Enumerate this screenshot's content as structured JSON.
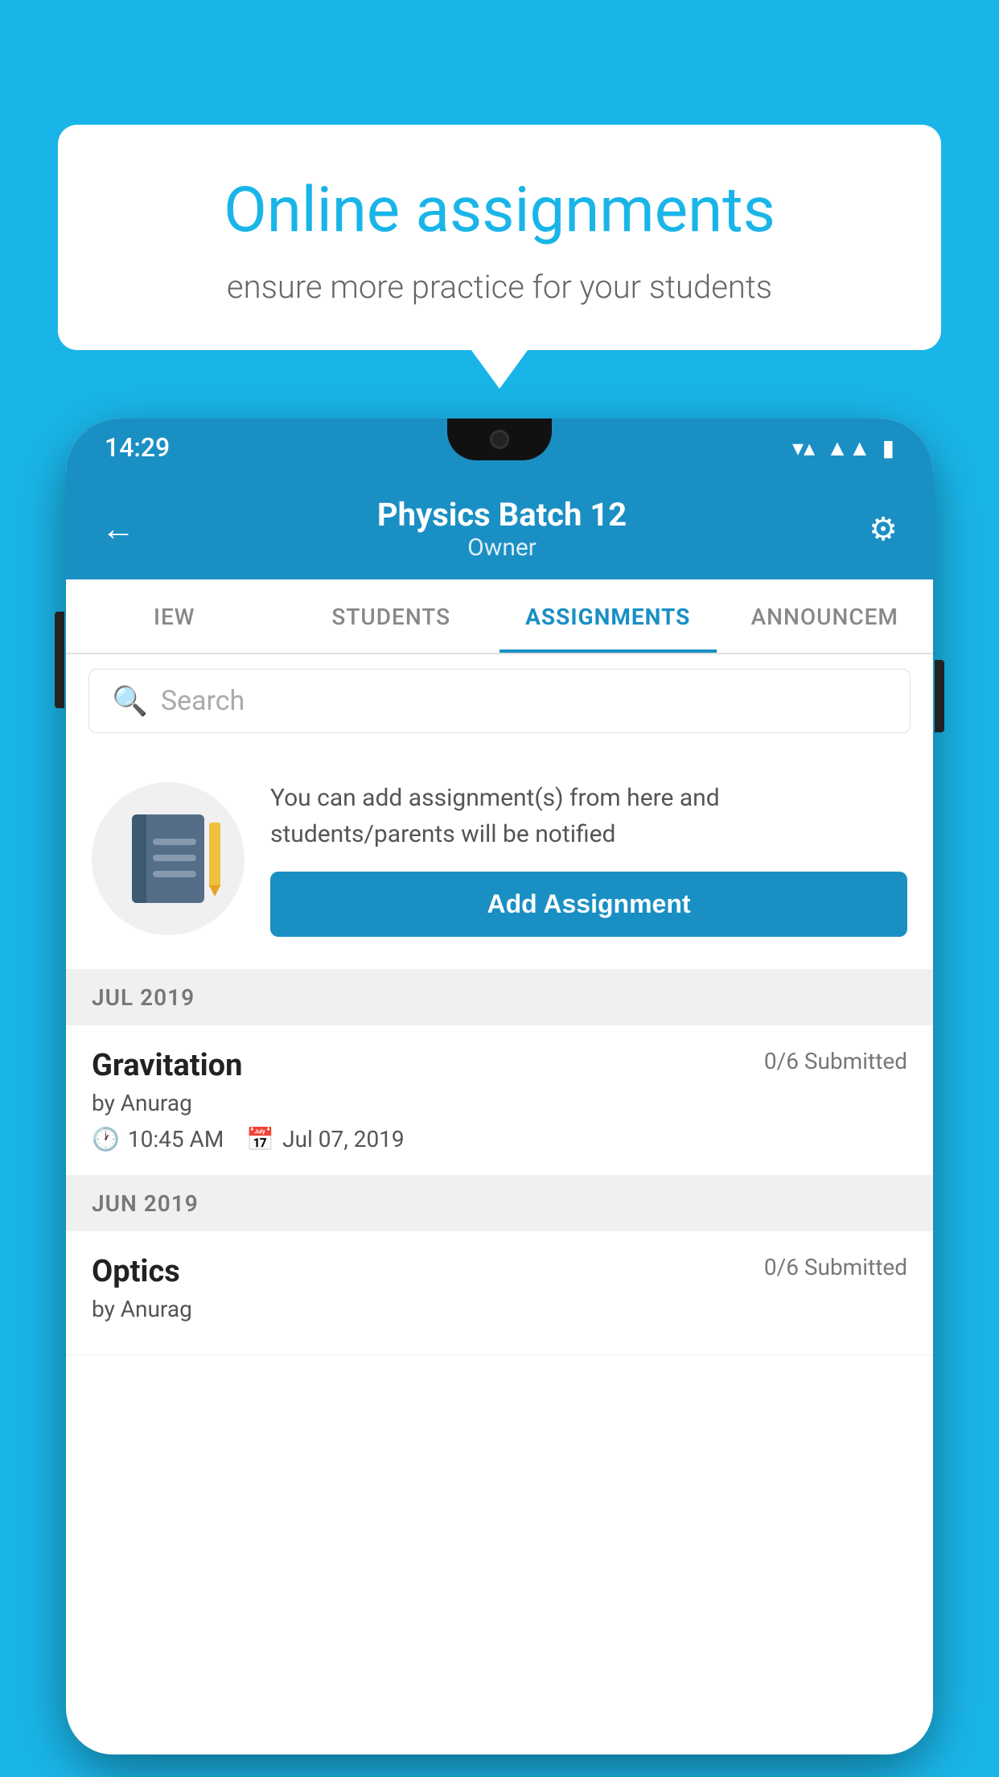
{
  "background": {
    "color": "#1ab5e8"
  },
  "speech_bubble": {
    "title": "Online assignments",
    "subtitle": "ensure more practice for your students"
  },
  "phone": {
    "status_bar": {
      "time": "14:29",
      "wifi": "wifi",
      "signal": "signal",
      "battery": "battery"
    },
    "header": {
      "title": "Physics Batch 12",
      "subtitle": "Owner",
      "back_label": "←",
      "settings_label": "⚙"
    },
    "tabs": [
      {
        "label": "IEW",
        "active": false
      },
      {
        "label": "STUDENTS",
        "active": false
      },
      {
        "label": "ASSIGNMENTS",
        "active": true
      },
      {
        "label": "ANNOUNCEM",
        "active": false
      }
    ],
    "search": {
      "placeholder": "Search"
    },
    "add_assignment": {
      "description": "You can add assignment(s) from here and students/parents will be notified",
      "button_label": "Add Assignment"
    },
    "sections": [
      {
        "month": "JUL 2019",
        "assignments": [
          {
            "title": "Gravitation",
            "submitted": "0/6 Submitted",
            "by": "by Anurag",
            "time": "10:45 AM",
            "date": "Jul 07, 2019"
          }
        ]
      },
      {
        "month": "JUN 2019",
        "assignments": [
          {
            "title": "Optics",
            "submitted": "0/6 Submitted",
            "by": "by Anurag",
            "time": "",
            "date": ""
          }
        ]
      }
    ]
  }
}
